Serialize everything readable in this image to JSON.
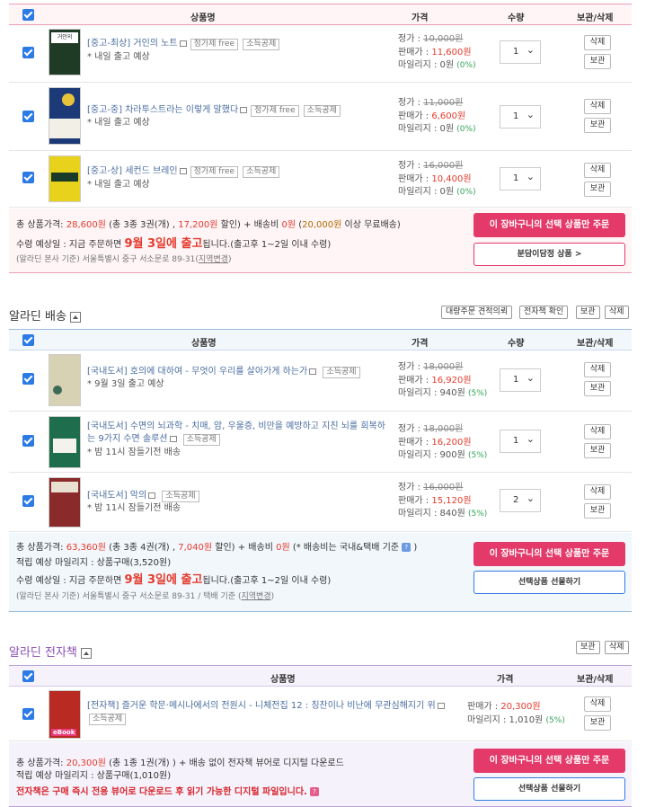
{
  "columns": {
    "name": "상품명",
    "price": "가격",
    "qty": "수량",
    "action": "보관/삭제"
  },
  "buttons": {
    "delete": "삭제",
    "keep": "보관"
  },
  "price_labels": {
    "list": "정가 : ",
    "sale": "판매가 : ",
    "mileage": "마일리지 : "
  },
  "used": {
    "items": [
      {
        "title": "[중고-최상] 거인의 노트",
        "tags": [
          "정가제 free",
          "소득공제"
        ],
        "note": "* 내일 출고 예상",
        "list": "10,000원",
        "sale": "11,600원",
        "mileage": "0원",
        "rate": "(0%)",
        "qty": "1",
        "cover_color": "#1f3b26"
      },
      {
        "title": "[중고-중] 차라투스트라는 이렇게 말했다",
        "tags": [
          "정가제 free",
          "소득공제"
        ],
        "note": "* 내일 출고 예상",
        "list": "11,000원",
        "sale": "6,600원",
        "mileage": "0원",
        "rate": "(0%)",
        "qty": "1",
        "cover_color": "#1d3a78"
      },
      {
        "title": "[중고-상] 세컨드 브레인",
        "tags": [
          "정가제 free",
          "소득공제"
        ],
        "note": "* 내일 출고 예상",
        "list": "16,000원",
        "sale": "10,400원",
        "mileage": "0원",
        "rate": "(0%)",
        "qty": "1",
        "cover_color": "#e8d21c"
      }
    ],
    "summary": {
      "l1a": "총 상품가격: ",
      "total": "28,600원",
      "l1b": " (총 3종 3권(개) , ",
      "discount": "17,200원",
      "l1c": " 할인) + 배송비 ",
      "ship": "0원",
      "l1d": " (",
      "free": "20,000원",
      "l1e": " 이상 무료배송)",
      "l2a": "수령 예상일 : 지금 주문하면 ",
      "date": "9월 3일에 출고",
      "l2b": "됩니다.(출고후 1~2일 이내 수령)",
      "l3": "(알라딘 본사 기준) 서울특별시 중구 서소문로 89-31(",
      "l3link": "지역변경",
      "l3end": ")",
      "order": "이 장바구니의 선택 상품만 주문",
      "secondary": "분담이담정 상품 >"
    }
  },
  "delivery": {
    "title": "알라딘 배송",
    "top_buttons": [
      "대량주문 견적의뢰",
      "전자책 확인",
      "보관",
      "삭제"
    ],
    "items": [
      {
        "title": "[국내도서] 호의에 대하여 - 무엇이 우리를 살아가게 하는가",
        "tags": [
          "소득공제"
        ],
        "note": "* 9월 3일 출고 예상",
        "list": "18,000원",
        "sale": "16,920원",
        "mileage": "940원",
        "rate": "(5%)",
        "qty": "1",
        "cover_color": "#d8d2b4"
      },
      {
        "title": "[국내도서] 수면의 뇌과학 - 치매, 암, 우울증, 비만을 예방하고 지친 뇌를 회복하는 9가지 수면 솔루션",
        "tags": [
          "소득공제"
        ],
        "note": "* 밤 11시 잠들기전 배송",
        "list": "18,000원",
        "sale": "16,200원",
        "mileage": "900원",
        "rate": "(5%)",
        "qty": "1",
        "cover_color": "#1e6e4e"
      },
      {
        "title": "[국내도서] 악의",
        "tags": [
          "소득공제"
        ],
        "note": "* 밤 11시 잠들기전 배송",
        "list": "16,000원",
        "sale": "15,120원",
        "mileage": "840원",
        "rate": "(5%)",
        "qty": "2",
        "cover_color": "#8a2a2a"
      }
    ],
    "summary": {
      "l1a": "총 상품가격: ",
      "total": "63,360원",
      "l1b": " (총 3종 4권(개) , ",
      "discount": "7,040원",
      "l1c": " 할인) + 배송비 ",
      "ship": "0원",
      "l1d": "  (* 배송비는 국내&택배 기준 ",
      "l1e": " )",
      "l2": "적립 예상 마일리지 : 상품구매(3,520원)",
      "l3a": "수령 예상일 : 지금 주문하면 ",
      "date": "9월 3일에 출고",
      "l3b": "됩니다.(출고후 1~2일 이내 수령)",
      "l4": "(알라딘 본사 기준) 서울특별시 중구 서소문로 89-31 / 택배 기준 (",
      "l4link": "지역변경",
      "l4end": ")",
      "order": "이 장바구니의 선택 상품만 주문",
      "gift": "선택상품 선물하기"
    }
  },
  "ebook": {
    "title": "알라딘 전자책",
    "top_buttons": [
      "보관",
      "삭제"
    ],
    "item": {
      "title": "[전자책] 즐거운 학문·메시나에서의 전원시 - 니체전집 12 : 칭찬이나 비난에 무관심해지기 위",
      "tags": [
        "소득공제"
      ],
      "sale": "20,300원",
      "mileage": "1,010원",
      "rate": "(5%)",
      "cover_color": "#b82a22",
      "ebook_label": "eBook"
    },
    "summary": {
      "l1a": "총 상품가격: ",
      "total": "20,300원",
      "l1b": " (총 1종 1권(개) ) + 배송 없이 전자책 뷰어로 디지털 다운로드",
      "l2": "적립 예상 마일리지 : 상품구매(1,010원)",
      "l3": "전자책은 구매 즉시 전용 뷰어로 다운로드 후 읽기 가능한 디지털 파일입니다.",
      "order": "이 장바구니의 선택 상품만 주문",
      "gift": "선택상품 선물하기"
    }
  }
}
